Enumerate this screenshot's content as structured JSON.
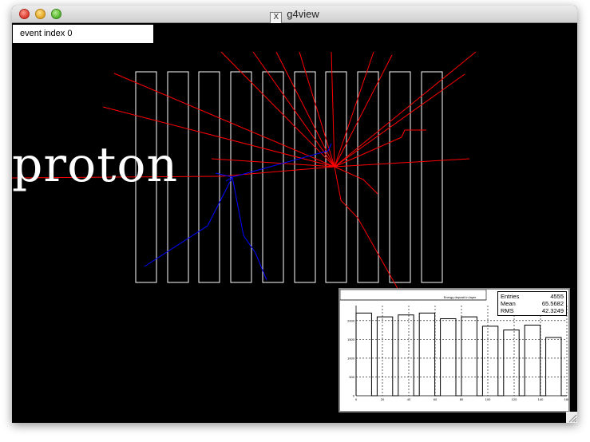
{
  "window": {
    "title": "g4view",
    "app_icon": "x11-icon"
  },
  "event_label": "event index 0",
  "particle_label": "proton",
  "colors": {
    "track_charged": "#ff0000",
    "track_neutral": "#0000ff",
    "detector": "#ffffff",
    "background": "#000000"
  },
  "histogram": {
    "title": "Energy deposit in layer",
    "stats": [
      {
        "label": "Entries",
        "value": "4555"
      },
      {
        "label": "Mean",
        "value": "65.5682"
      },
      {
        "label": "RMS",
        "value": "42.3249"
      }
    ],
    "y_ticks": [
      "0",
      "500",
      "1000",
      "1500",
      "2000"
    ],
    "x_ticks": [
      "0",
      "20",
      "40",
      "60",
      "80",
      "100",
      "120",
      "140",
      "160"
    ]
  },
  "chart_data": {
    "type": "bar",
    "title": "Energy deposit in layer",
    "xlim": [
      0,
      160
    ],
    "ylim": [
      0,
      2400
    ],
    "categories": [
      "0-16",
      "16-32",
      "32-48",
      "48-64",
      "64-80",
      "80-96",
      "96-112",
      "112-128",
      "128-144",
      "144-160"
    ],
    "values": [
      2200,
      2100,
      2150,
      2200,
      2050,
      2100,
      1850,
      1750,
      1880,
      1550
    ],
    "grid": true,
    "legend": "top-right"
  }
}
